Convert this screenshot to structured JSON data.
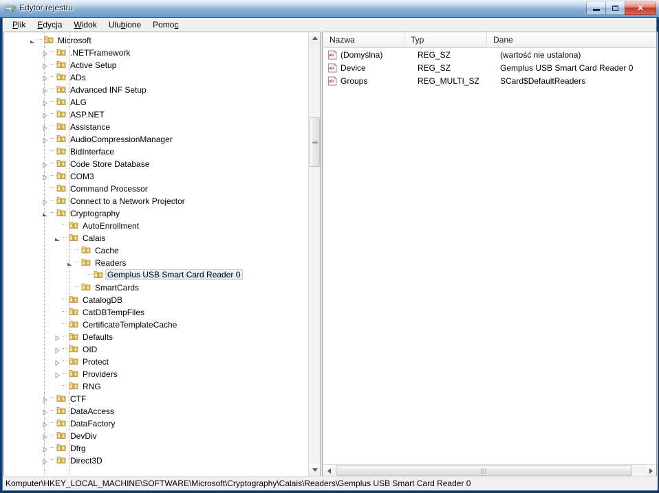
{
  "window": {
    "title": "Edytor rejestru",
    "icon": "registry-editor-icon",
    "buttons": {
      "minimize": "–",
      "maximize": "□",
      "close": "✕"
    }
  },
  "menu": {
    "items": [
      {
        "label": "Plik",
        "accel": "P"
      },
      {
        "label": "Edycja",
        "accel": "E"
      },
      {
        "label": "Widok",
        "accel": "W"
      },
      {
        "label": "Ulubione",
        "accel": "b"
      },
      {
        "label": "Pomoc",
        "accel": "c"
      }
    ]
  },
  "tree": {
    "rows": [
      {
        "label": "Microsoft",
        "depth": 1,
        "state": "expanded",
        "selected": false
      },
      {
        "label": ".NETFramework",
        "depth": 2,
        "state": "collapsed",
        "selected": false
      },
      {
        "label": "Active Setup",
        "depth": 2,
        "state": "collapsed",
        "selected": false
      },
      {
        "label": "ADs",
        "depth": 2,
        "state": "collapsed",
        "selected": false
      },
      {
        "label": "Advanced INF Setup",
        "depth": 2,
        "state": "collapsed",
        "selected": false
      },
      {
        "label": "ALG",
        "depth": 2,
        "state": "collapsed",
        "selected": false
      },
      {
        "label": "ASP.NET",
        "depth": 2,
        "state": "collapsed",
        "selected": false
      },
      {
        "label": "Assistance",
        "depth": 2,
        "state": "collapsed",
        "selected": false
      },
      {
        "label": "AudioCompressionManager",
        "depth": 2,
        "state": "collapsed",
        "selected": false
      },
      {
        "label": "BidInterface",
        "depth": 2,
        "state": "leaf",
        "selected": false
      },
      {
        "label": "Code Store Database",
        "depth": 2,
        "state": "collapsed",
        "selected": false
      },
      {
        "label": "COM3",
        "depth": 2,
        "state": "collapsed",
        "selected": false
      },
      {
        "label": "Command Processor",
        "depth": 2,
        "state": "leaf",
        "selected": false
      },
      {
        "label": "Connect to a Network Projector",
        "depth": 2,
        "state": "collapsed",
        "selected": false
      },
      {
        "label": "Cryptography",
        "depth": 2,
        "state": "expanded",
        "selected": false
      },
      {
        "label": "AutoEnrollment",
        "depth": 3,
        "state": "leaf",
        "selected": false
      },
      {
        "label": "Calais",
        "depth": 3,
        "state": "expanded",
        "selected": false
      },
      {
        "label": "Cache",
        "depth": 4,
        "state": "leaf",
        "selected": false
      },
      {
        "label": "Readers",
        "depth": 4,
        "state": "expanded",
        "selected": false
      },
      {
        "label": "Gemplus USB Smart Card Reader 0",
        "depth": 5,
        "state": "leaf",
        "selected": true
      },
      {
        "label": "SmartCards",
        "depth": 4,
        "state": "leaf",
        "selected": false
      },
      {
        "label": "CatalogDB",
        "depth": 3,
        "state": "leaf",
        "selected": false
      },
      {
        "label": "CatDBTempFiles",
        "depth": 3,
        "state": "leaf",
        "selected": false
      },
      {
        "label": "CertificateTemplateCache",
        "depth": 3,
        "state": "leaf",
        "selected": false
      },
      {
        "label": "Defaults",
        "depth": 3,
        "state": "collapsed",
        "selected": false
      },
      {
        "label": "OID",
        "depth": 3,
        "state": "collapsed",
        "selected": false
      },
      {
        "label": "Protect",
        "depth": 3,
        "state": "collapsed",
        "selected": false
      },
      {
        "label": "Providers",
        "depth": 3,
        "state": "collapsed",
        "selected": false
      },
      {
        "label": "RNG",
        "depth": 3,
        "state": "leaf",
        "selected": false
      },
      {
        "label": "CTF",
        "depth": 2,
        "state": "collapsed",
        "selected": false
      },
      {
        "label": "DataAccess",
        "depth": 2,
        "state": "collapsed",
        "selected": false
      },
      {
        "label": "DataFactory",
        "depth": 2,
        "state": "collapsed",
        "selected": false
      },
      {
        "label": "DevDiv",
        "depth": 2,
        "state": "collapsed",
        "selected": false
      },
      {
        "label": "Dfrg",
        "depth": 2,
        "state": "collapsed",
        "selected": false
      },
      {
        "label": "Direct3D",
        "depth": 2,
        "state": "collapsed",
        "selected": false
      }
    ],
    "scrollbar": {
      "up_arrow": "scroll-up-arrow",
      "down_arrow": "scroll-down-arrow"
    }
  },
  "list": {
    "columns": [
      {
        "label": "Nazwa"
      },
      {
        "label": "Typ"
      },
      {
        "label": "Dane"
      }
    ],
    "rows": [
      {
        "icon": "string-value-icon",
        "name": "(Domyślna)",
        "type": "REG_SZ",
        "data": "(wartość nie ustalona)"
      },
      {
        "icon": "string-value-icon",
        "name": "Device",
        "type": "REG_SZ",
        "data": "Gemplus USB Smart Card Reader 0"
      },
      {
        "icon": "string-value-icon",
        "name": "Groups",
        "type": "REG_MULTI_SZ",
        "data": "SCard$DefaultReaders"
      }
    ],
    "scrollbar": {
      "left_arrow": "scroll-left-arrow",
      "right_arrow": "scroll-right-arrow"
    }
  },
  "statusbar": {
    "path": "Komputer\\HKEY_LOCAL_MACHINE\\SOFTWARE\\Microsoft\\Cryptography\\Calais\\Readers\\Gemplus USB Smart Card Reader 0"
  },
  "colors": {
    "selection_border": "#b8d6f0",
    "folder": "#e8c35a",
    "value_icon_text": "#c0392b",
    "title_gradient_top": "#cfe0f0",
    "close_button": "#c23a26"
  }
}
